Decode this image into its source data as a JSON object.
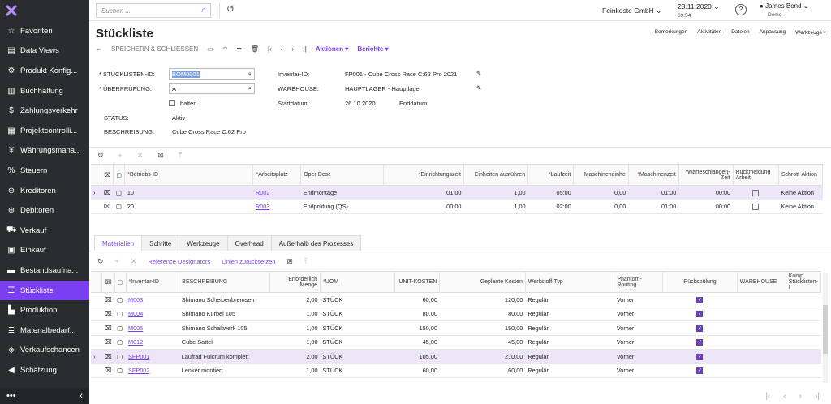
{
  "sidebar": {
    "items": [
      {
        "label": "Favoriten",
        "icon": "star-icon"
      },
      {
        "label": "Data Views",
        "icon": "chart-icon"
      },
      {
        "label": "Produkt Konfig...",
        "icon": "car-icon"
      },
      {
        "label": "Buchhaltung",
        "icon": "book-icon"
      },
      {
        "label": "Zahlungsverkehr",
        "icon": "dollar-icon"
      },
      {
        "label": "Projektcontrolli...",
        "icon": "project-icon"
      },
      {
        "label": "Währungsmana...",
        "icon": "currency-icon"
      },
      {
        "label": "Steuern",
        "icon": "percent-icon"
      },
      {
        "label": "Kreditoren",
        "icon": "minus-circle-icon"
      },
      {
        "label": "Debitoren",
        "icon": "plus-circle-icon"
      },
      {
        "label": "Verkauf",
        "icon": "cart-icon"
      },
      {
        "label": "Einkauf",
        "icon": "bag-icon"
      },
      {
        "label": "Bestandsaufna...",
        "icon": "truck-icon"
      },
      {
        "label": "Stückliste",
        "icon": "list-icon"
      },
      {
        "label": "Produktion",
        "icon": "factory-icon"
      },
      {
        "label": "Materialbedarf...",
        "icon": "material-icon"
      },
      {
        "label": "Verkaufschancen",
        "icon": "tag-icon"
      },
      {
        "label": "Schätzung",
        "icon": "megaphone-icon"
      }
    ],
    "active_index": 13,
    "more_label": "•••",
    "collapse_label": "‹"
  },
  "topbar": {
    "search_placeholder": "Suchen ...",
    "company": "Feinkoste GmbH",
    "date": "23.11.2020",
    "time": "09:54",
    "help": "?",
    "user_name": "James Bond",
    "user_role": "Demo"
  },
  "page": {
    "title": "Stückliste",
    "right_links": [
      "Bemerkungen",
      "Aktivitäten",
      "Dateien",
      "Anpassung",
      "Werkzeuge ▾"
    ],
    "toolbar": {
      "save_close": "SPEICHERN & SCHLIESSEN",
      "actions": "Aktionen ▾",
      "reports": "Berichte ▾"
    }
  },
  "form": {
    "bom_id_label": "* STÜCKLISTEN-ID:",
    "bom_id": "BOM0001",
    "revision_label": "* ÜBERPRÜFUNG:",
    "revision": "A",
    "hold_label": "halten",
    "status_label": "STATUS:",
    "status": "Aktiv",
    "description_label": "BESCHREIBUNG:",
    "description": "Cube Cross Race C:62 Pro",
    "inventory_label": "Inventar-ID:",
    "inventory": "FP001 - Cube Cross Race C:62 Pro 2021",
    "warehouse_label": "WAREHOUSE:",
    "warehouse": "HAUPTLAGER - Hauptlager",
    "start_label": "Startdatum:",
    "start": "26.10.2020",
    "end_label": "Enddatum:"
  },
  "operations": {
    "headers": [
      "*Betriebs-ID",
      "*Arbeitsplatz",
      "Oper Desc",
      "*Einrichtungszeit",
      "Einheiten ausführen",
      "*Laufzeit",
      "Maschineneinhe",
      "*Maschinenzeit",
      "*Warteschlangen-Zeit",
      "Rückmeldung Arbeit",
      "Schrott-Aktion"
    ],
    "rows": [
      {
        "id": "10",
        "wc": "R002",
        "desc": "Endmontage",
        "setup": "01:00",
        "units": "1,00",
        "run": "05:00",
        "mach_units": "0,00",
        "mach_time": "01:00",
        "queue": "00:00",
        "action": "Keine Aktion"
      },
      {
        "id": "20",
        "wc": "R003",
        "desc": "Endprüfung (QS)",
        "setup": "00:00",
        "units": "1,00",
        "run": "02:00",
        "mach_units": "0,00",
        "mach_time": "01:00",
        "queue": "00:00",
        "action": "Keine Aktion"
      }
    ]
  },
  "tabs": [
    "Materialien",
    "Schritte",
    "Werkzeuge",
    "Overhead",
    "Außerhalb des Prozesses"
  ],
  "materials_toolbar": {
    "ref": "Reference Designators",
    "reset": "Linien zurücksetzen"
  },
  "materials": {
    "headers": [
      "*Inventar-ID",
      "BESCHREIBUNG",
      "Erforderlich Menge",
      "*UOM",
      "UNIT-KOSTEN",
      "Geplante Kosten",
      "Werkstoff-Typ",
      "Phantom-Routing",
      "Rückspülung",
      "WAREHOUSE",
      "Komp Stücklisten-I"
    ],
    "rows": [
      {
        "id": "M003",
        "desc": "Shimano Scheibenbremsen",
        "qty": "2,00",
        "uom": "STÜCK",
        "unit": "60,00",
        "plan": "120,00",
        "type": "Regulär",
        "phantom": "Vorher"
      },
      {
        "id": "M004",
        "desc": "Shimano Kurbel 105",
        "qty": "1,00",
        "uom": "STÜCK",
        "unit": "80,00",
        "plan": "80,00",
        "type": "Regulär",
        "phantom": "Vorher"
      },
      {
        "id": "M005",
        "desc": "Shimano Schaltwerk 105",
        "qty": "1,00",
        "uom": "STÜCK",
        "unit": "150,00",
        "plan": "150,00",
        "type": "Regulär",
        "phantom": "Vorher"
      },
      {
        "id": "M012",
        "desc": "Cube Sattel",
        "qty": "1,00",
        "uom": "STÜCK",
        "unit": "45,00",
        "plan": "45,00",
        "type": "Regulär",
        "phantom": "Vorher"
      },
      {
        "id": "SFP001",
        "desc": "Laufrad Fulcrum komplett",
        "qty": "2,00",
        "uom": "STÜCK",
        "unit": "105,00",
        "plan": "210,00",
        "type": "Regulär",
        "phantom": "Vorher"
      },
      {
        "id": "SFP002",
        "desc": "Lenker montiert",
        "qty": "1,00",
        "uom": "STÜCK",
        "unit": "60,00",
        "plan": "60,00",
        "type": "Regulär",
        "phantom": "Vorher"
      }
    ]
  },
  "colors": {
    "accent": "#7b3ff2",
    "sidebar": "#2a2c30"
  }
}
